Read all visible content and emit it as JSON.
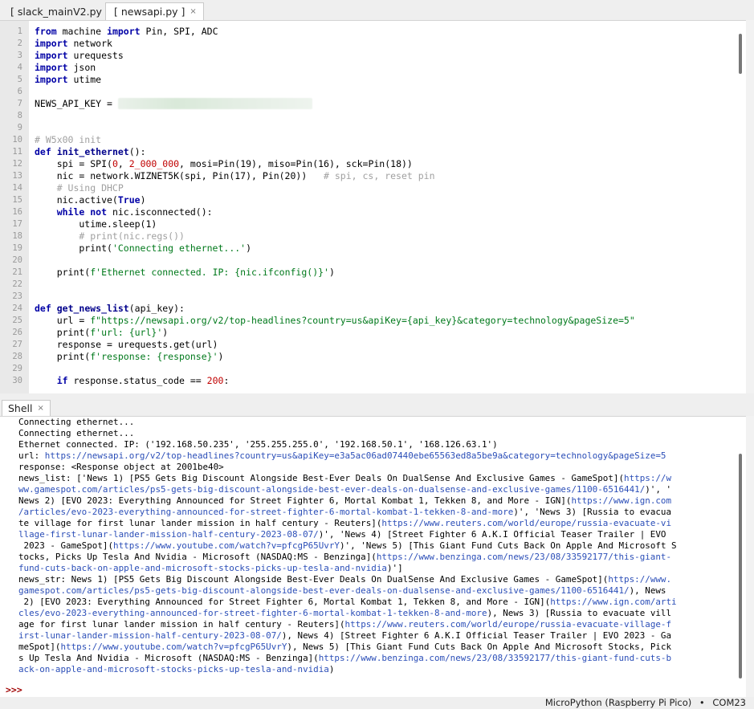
{
  "editor_tabs": [
    {
      "label": "[ slack_mainV2.py ]",
      "active": false
    },
    {
      "label": "[ newsapi.py ]",
      "active": true
    }
  ],
  "tab_close_glyph": "×",
  "code_lines": [
    [
      [
        "kw",
        "from"
      ],
      [
        "n",
        " machine "
      ],
      [
        "kw",
        "import"
      ],
      [
        "n",
        " Pin, SPI, ADC"
      ]
    ],
    [
      [
        "kw",
        "import"
      ],
      [
        "n",
        " network"
      ]
    ],
    [
      [
        "kw",
        "import"
      ],
      [
        "n",
        " urequests"
      ]
    ],
    [
      [
        "kw",
        "import"
      ],
      [
        "n",
        " json"
      ]
    ],
    [
      [
        "kw",
        "import"
      ],
      [
        "n",
        " utime"
      ]
    ],
    [],
    [
      [
        "n",
        "NEWS_API_KEY = "
      ],
      [
        "redact",
        ""
      ]
    ],
    [],
    [],
    [
      [
        "cm",
        "# W5x00 init"
      ]
    ],
    [
      [
        "kw",
        "def"
      ],
      [
        "n",
        " "
      ],
      [
        "fn",
        "init_ethernet"
      ],
      [
        "n",
        "():"
      ]
    ],
    [
      [
        "n",
        "    spi = SPI("
      ],
      [
        "nm",
        "0"
      ],
      [
        "n",
        ", "
      ],
      [
        "nm",
        "2_000_000"
      ],
      [
        "n",
        ", mosi=Pin(19), miso=Pin(16), sck=Pin(18))"
      ]
    ],
    [
      [
        "n",
        "    nic = network.WIZNET5K(spi, Pin(17), Pin(20))   "
      ],
      [
        "cm",
        "# spi, cs, reset pin"
      ]
    ],
    [
      [
        "cm",
        "    # Using DHCP"
      ]
    ],
    [
      [
        "n",
        "    nic.active("
      ],
      [
        "kw",
        "True"
      ],
      [
        "n",
        ")"
      ]
    ],
    [
      [
        "n",
        "    "
      ],
      [
        "kw",
        "while not"
      ],
      [
        "n",
        " nic.isconnected():"
      ]
    ],
    [
      [
        "n",
        "        utime.sleep(1)"
      ]
    ],
    [
      [
        "cm",
        "        # print(nic.regs())"
      ]
    ],
    [
      [
        "n",
        "        print("
      ],
      [
        "st",
        "'Connecting ethernet...'"
      ],
      [
        "n",
        ")"
      ]
    ],
    [],
    [
      [
        "n",
        "    print("
      ],
      [
        "st",
        "f'Ethernet connected. IP: {nic.ifconfig()}'"
      ],
      [
        "n",
        ")"
      ]
    ],
    [],
    [],
    [
      [
        "kw",
        "def"
      ],
      [
        "n",
        " "
      ],
      [
        "fn",
        "get_news_list"
      ],
      [
        "n",
        "(api_key):"
      ]
    ],
    [
      [
        "n",
        "    url = "
      ],
      [
        "st",
        "f\"https://newsapi.org/v2/top-headlines?country=us&apiKey={api_key}&category=technology&pageSize=5\""
      ]
    ],
    [
      [
        "n",
        "    print("
      ],
      [
        "st",
        "f'url: {url}'"
      ],
      [
        "n",
        ")"
      ]
    ],
    [
      [
        "n",
        "    response = urequests.get(url)"
      ]
    ],
    [
      [
        "n",
        "    print("
      ],
      [
        "st",
        "f'response: {response}'"
      ],
      [
        "n",
        ")"
      ]
    ],
    [],
    [
      [
        "n",
        "    "
      ],
      [
        "kw",
        "if"
      ],
      [
        "n",
        " response.status_code == "
      ],
      [
        "nm",
        "200"
      ],
      [
        "n",
        ":"
      ]
    ]
  ],
  "shell_tab": {
    "label": "Shell"
  },
  "shell_lines": [
    [
      [
        "t",
        "Connecting ethernet..."
      ]
    ],
    [
      [
        "t",
        "Connecting ethernet..."
      ]
    ],
    [
      [
        "t",
        "Ethernet connected. IP: ('192.168.50.235', '255.255.255.0', '192.168.50.1', '168.126.63.1')"
      ]
    ],
    [
      [
        "t",
        "url: "
      ],
      [
        "u",
        "https://newsapi.org/v2/top-headlines?country=us&apiKey=e3a5ac06ad07440ebe65563ed8a5be9a&category=technology&pageSize=5"
      ]
    ],
    [
      [
        "t",
        "response: <Response object at 2001be40>"
      ]
    ],
    [
      [
        "t",
        "news_list: ['News 1) [PS5 Gets Big Discount Alongside Best-Ever Deals On DualSense And Exclusive Games - GameSpot]("
      ],
      [
        "u",
        "https://w"
      ]
    ],
    [
      [
        "u",
        "ww.gamespot.com/articles/ps5-gets-big-discount-alongside-best-ever-deals-on-dualsense-and-exclusive-games/1100-6516441/"
      ],
      [
        "t",
        ")', '"
      ]
    ],
    [
      [
        "t",
        "News 2) [EVO 2023: Everything Announced for Street Fighter 6, Mortal Kombat 1, Tekken 8, and More - IGN]("
      ],
      [
        "u",
        "https://www.ign.com"
      ]
    ],
    [
      [
        "u",
        "/articles/evo-2023-everything-announced-for-street-fighter-6-mortal-kombat-1-tekken-8-and-more"
      ],
      [
        "t",
        ")', 'News 3) [Russia to evacua"
      ]
    ],
    [
      [
        "t",
        "te village for first lunar lander mission in half century - Reuters]("
      ],
      [
        "u",
        "https://www.reuters.com/world/europe/russia-evacuate-vi"
      ]
    ],
    [
      [
        "u",
        "llage-first-lunar-lander-mission-half-century-2023-08-07/"
      ],
      [
        "t",
        ")', 'News 4) [Street Fighter 6 A.K.I Official Teaser Trailer | EVO"
      ]
    ],
    [
      [
        "t",
        " 2023 - GameSpot]("
      ],
      [
        "u",
        "https://www.youtube.com/watch?v=pfcgP65UvrY"
      ],
      [
        "t",
        ")', 'News 5) [This Giant Fund Cuts Back On Apple And Microsoft S"
      ]
    ],
    [
      [
        "t",
        "tocks, Picks Up Tesla And Nvidia - Microsoft (NASDAQ:MS - Benzinga]("
      ],
      [
        "u",
        "https://www.benzinga.com/news/23/08/33592177/this-giant-"
      ]
    ],
    [
      [
        "u",
        "fund-cuts-back-on-apple-and-microsoft-stocks-picks-up-tesla-and-nvidia"
      ],
      [
        "t",
        ")']"
      ]
    ],
    [
      [
        "t",
        "news_str: News 1) [PS5 Gets Big Discount Alongside Best-Ever Deals On DualSense And Exclusive Games - GameSpot]("
      ],
      [
        "u",
        "https://www."
      ]
    ],
    [
      [
        "u",
        "gamespot.com/articles/ps5-gets-big-discount-alongside-best-ever-deals-on-dualsense-and-exclusive-games/1100-6516441/"
      ],
      [
        "t",
        "), News"
      ]
    ],
    [
      [
        "t",
        " 2) [EVO 2023: Everything Announced for Street Fighter 6, Mortal Kombat 1, Tekken 8, and More - IGN]("
      ],
      [
        "u",
        "https://www.ign.com/arti"
      ]
    ],
    [
      [
        "u",
        "cles/evo-2023-everything-announced-for-street-fighter-6-mortal-kombat-1-tekken-8-and-more"
      ],
      [
        "t",
        "), News 3) [Russia to evacuate vill"
      ]
    ],
    [
      [
        "t",
        "age for first lunar lander mission in half century - Reuters]("
      ],
      [
        "u",
        "https://www.reuters.com/world/europe/russia-evacuate-village-f"
      ]
    ],
    [
      [
        "u",
        "irst-lunar-lander-mission-half-century-2023-08-07/"
      ],
      [
        "t",
        "), News 4) [Street Fighter 6 A.K.I Official Teaser Trailer | EVO 2023 - Ga"
      ]
    ],
    [
      [
        "t",
        "meSpot]("
      ],
      [
        "u",
        "https://www.youtube.com/watch?v=pfcgP65UvrY"
      ],
      [
        "t",
        "), News 5) [This Giant Fund Cuts Back On Apple And Microsoft Stocks, Pick"
      ]
    ],
    [
      [
        "t",
        "s Up Tesla And Nvidia - Microsoft (NASDAQ:MS - Benzinga]("
      ],
      [
        "u",
        "https://www.benzinga.com/news/23/08/33592177/this-giant-fund-cuts-b"
      ]
    ],
    [
      [
        "u",
        "ack-on-apple-and-microsoft-stocks-picks-up-tesla-and-nvidia"
      ],
      [
        "t",
        ")"
      ]
    ]
  ],
  "shell_prompt": ">>>",
  "status": {
    "interpreter": "MicroPython (Raspberry Pi Pico)",
    "separator": "•",
    "port": "COM23"
  },
  "colors": {
    "keyword": "#0000a6",
    "string": "#00791b",
    "comment": "#a0a0a0",
    "number": "#c00000",
    "url": "#2c4fb8",
    "prompt": "#a00000"
  }
}
